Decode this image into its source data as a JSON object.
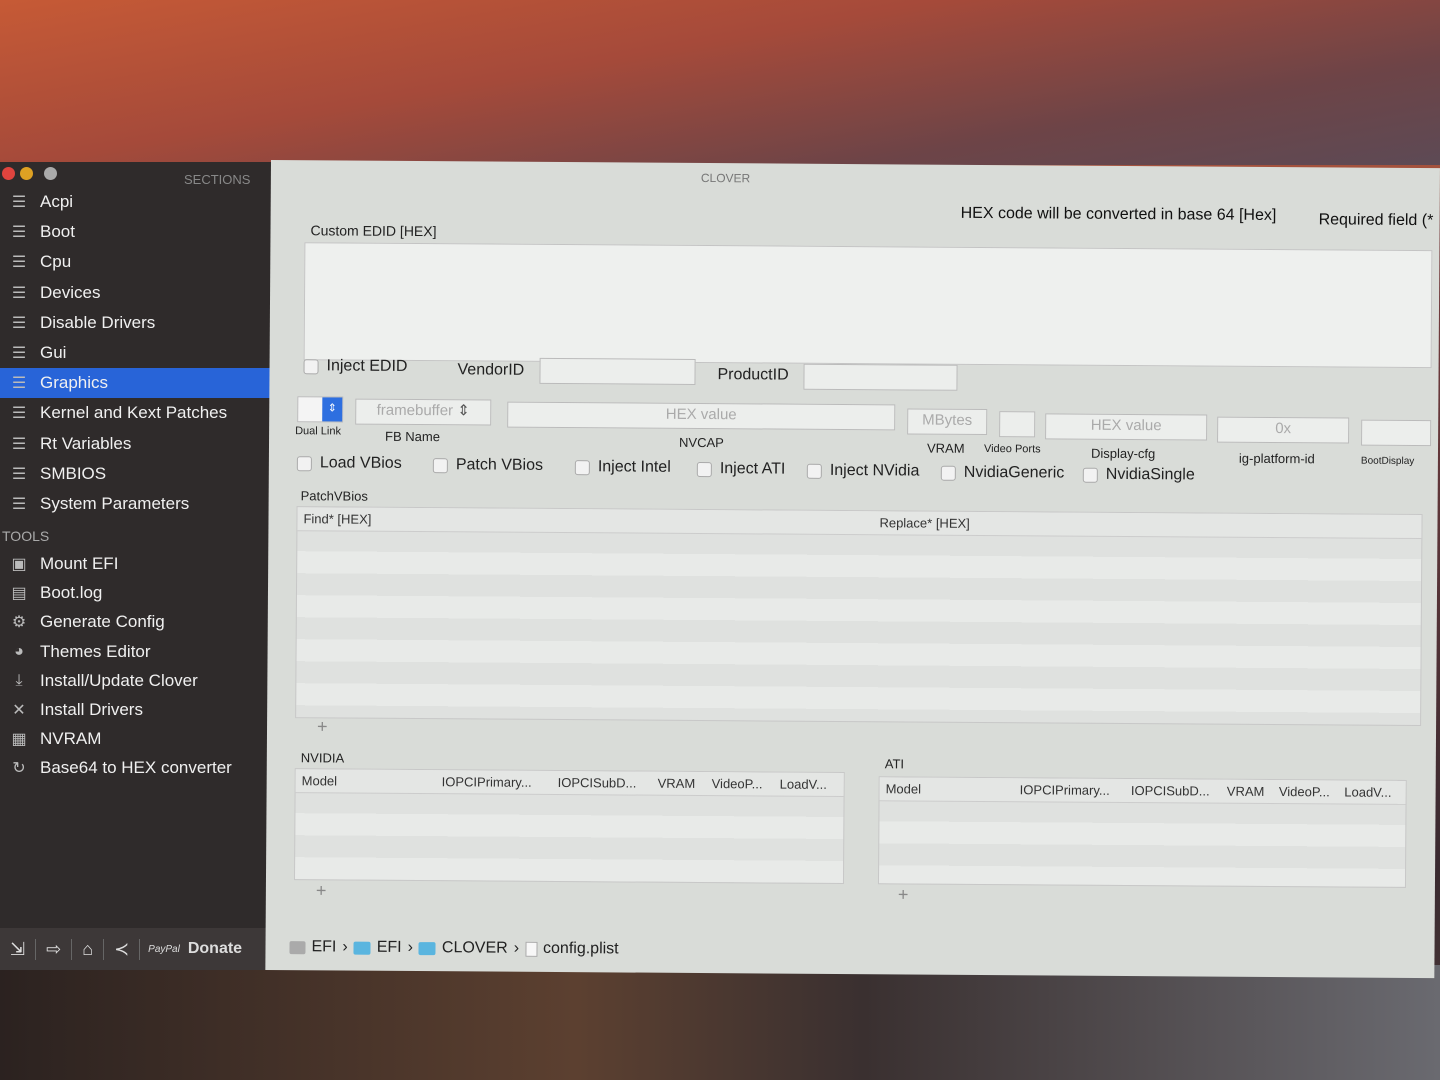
{
  "window": {
    "title": "CLOVER"
  },
  "sidebar": {
    "sections_label": "SECTIONS",
    "sections": [
      {
        "label": "Acpi"
      },
      {
        "label": "Boot"
      },
      {
        "label": "Cpu"
      },
      {
        "label": "Devices"
      },
      {
        "label": "Disable Drivers"
      },
      {
        "label": "Gui"
      },
      {
        "label": "Graphics",
        "selected": true
      },
      {
        "label": "Kernel and Kext Patches"
      },
      {
        "label": "Rt Variables"
      },
      {
        "label": "SMBIOS"
      },
      {
        "label": "System Parameters"
      }
    ],
    "tools_label": "TOOLS",
    "tools": [
      {
        "label": "Mount EFI",
        "icon": "disk-icon"
      },
      {
        "label": "Boot.log",
        "icon": "log-icon"
      },
      {
        "label": "Generate Config",
        "icon": "gear-icon"
      },
      {
        "label": "Themes Editor",
        "icon": "palette-icon"
      },
      {
        "label": "Install/Update Clover",
        "icon": "download-icon"
      },
      {
        "label": "Install Drivers",
        "icon": "tools-icon"
      },
      {
        "label": "NVRAM",
        "icon": "chip-icon"
      },
      {
        "label": "Base64 to HEX converter",
        "icon": "refresh-icon"
      }
    ],
    "bottom": {
      "paypal": "PayPal",
      "donate": "Donate"
    }
  },
  "main": {
    "note_hex": "HEX code will be converted in base 64 [Hex]",
    "note_required": "Required field (*",
    "custom_edid_label": "Custom EDID [HEX]",
    "inject_edid": "Inject EDID",
    "vendorid": "VendorID",
    "productid": "ProductID",
    "dual_link": "Dual Link",
    "fb_placeholder": "framebuffer",
    "fb_name": "FB Name",
    "nvcap_placeholder": "HEX value",
    "nvcap": "NVCAP",
    "vram_placeholder": "MBytes",
    "vram": "VRAM",
    "video_ports": "Video Ports",
    "display_cfg_placeholder": "HEX value",
    "display_cfg": "Display-cfg",
    "ig_placeholder": "0x",
    "ig_platform": "ig-platform-id",
    "boot_display": "BootDisplay",
    "checkboxes": [
      "Load VBios",
      "Patch VBios",
      "Inject Intel",
      "Inject ATI",
      "Inject NVidia",
      "NvidiaGeneric",
      "NvidiaSingle"
    ],
    "patchvbios_label": "PatchVBios",
    "patch_cols": [
      "Find* [HEX]",
      "Replace* [HEX]"
    ],
    "nvidia_label": "NVIDIA",
    "ati_label": "ATI",
    "card_cols": [
      "Model",
      "IOPCIPrimary...",
      "IOPCISubD...",
      "VRAM",
      "VideoP...",
      "LoadV..."
    ],
    "plus": "+",
    "minus": "−"
  },
  "path": [
    "EFI",
    "EFI",
    "CLOVER",
    "config.plist"
  ]
}
